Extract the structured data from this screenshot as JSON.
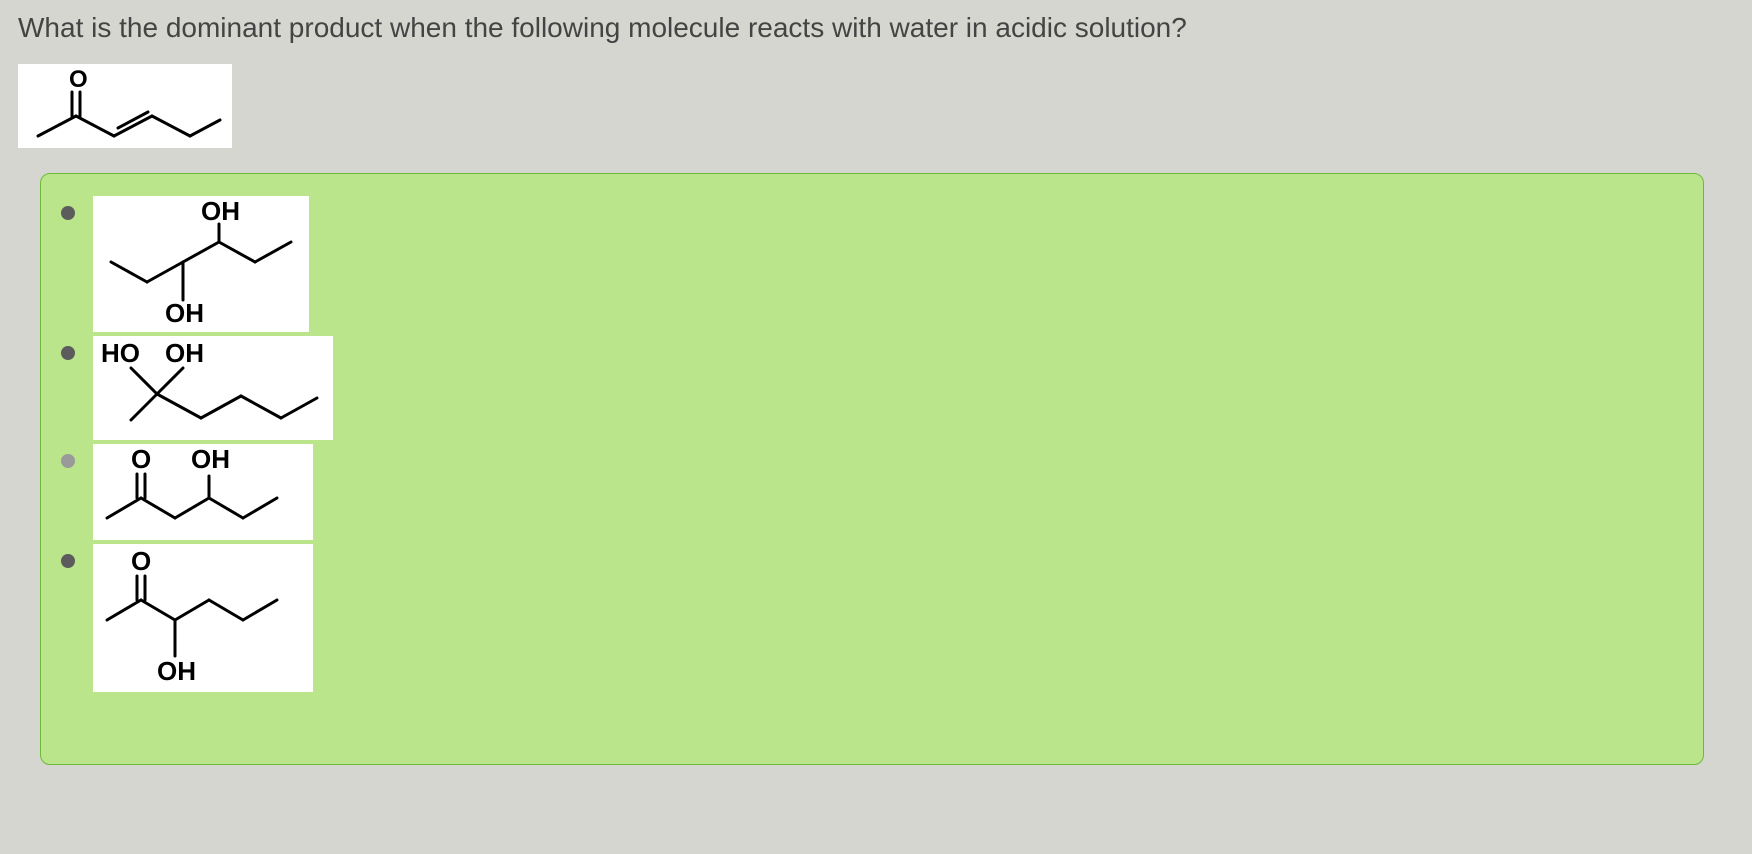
{
  "question": {
    "text": "What is the dominant product when the following molecule reacts with water in acidic solution?",
    "molecule_label_O": "O"
  },
  "options": {
    "a": {
      "label_top": "OH",
      "label_bottom": "OH"
    },
    "b": {
      "label_left": "HO",
      "label_right": "OH"
    },
    "c": {
      "label_left": "O",
      "label_right": "OH"
    },
    "d": {
      "label_top": "O",
      "label_bottom": "OH"
    }
  }
}
